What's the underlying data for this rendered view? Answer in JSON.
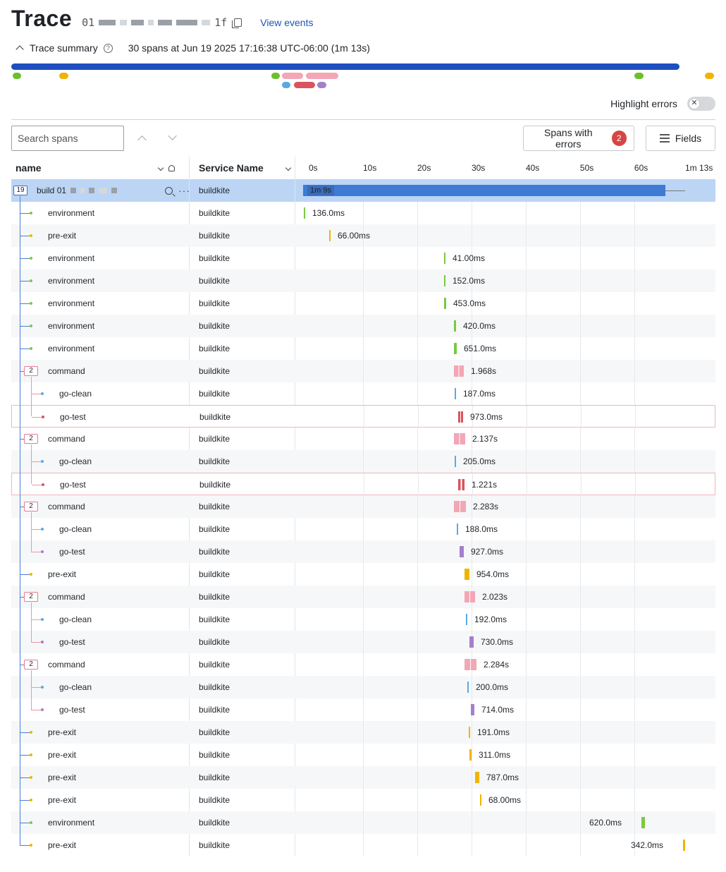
{
  "header": {
    "title": "Trace",
    "trace_id_prefix": "01",
    "trace_id_suffix": "1f",
    "view_events": "View events"
  },
  "summary": {
    "toggle_label": "Trace summary",
    "text": "30 spans at Jun 19 2025 17:16:38 UTC-06:00 (1m 13s)"
  },
  "highlight_errors": {
    "label": "Highlight errors",
    "enabled": false,
    "knob": "✕"
  },
  "toolbar": {
    "search_placeholder": "Search spans",
    "errors_label": "Spans with errors",
    "errors_count": "2",
    "fields_label": "Fields"
  },
  "columns": {
    "name": "name",
    "service": "Service Name"
  },
  "timeline_ticks": [
    "0s",
    "10s",
    "20s",
    "30s",
    "40s",
    "50s",
    "60s",
    "1m 13s"
  ],
  "colors": {
    "environment": "#7ac943",
    "pre-exit": "#f0b400",
    "command": "#f3a6b5",
    "go-clean": "#5aa9e6",
    "go-test": "#a57fcc",
    "go-test-error": "#d9545e",
    "root": "#3d7bd4"
  },
  "root_span": {
    "label": "build 01",
    "child_count": "19",
    "duration": "1m 9s",
    "service": "buildkite"
  },
  "spans": [
    {
      "name": "environment",
      "service": "buildkite",
      "duration": "136.0ms",
      "kind": "environment"
    },
    {
      "name": "pre-exit",
      "service": "buildkite",
      "duration": "66.00ms",
      "kind": "pre-exit"
    },
    {
      "name": "environment",
      "service": "buildkite",
      "duration": "41.00ms",
      "kind": "environment"
    },
    {
      "name": "environment",
      "service": "buildkite",
      "duration": "152.0ms",
      "kind": "environment"
    },
    {
      "name": "environment",
      "service": "buildkite",
      "duration": "453.0ms",
      "kind": "environment"
    },
    {
      "name": "environment",
      "service": "buildkite",
      "duration": "420.0ms",
      "kind": "environment"
    },
    {
      "name": "environment",
      "service": "buildkite",
      "duration": "651.0ms",
      "kind": "environment"
    },
    {
      "name": "command",
      "service": "buildkite",
      "duration": "1.968s",
      "kind": "command",
      "child_count": "2"
    },
    {
      "name": "go-clean",
      "service": "buildkite",
      "duration": "187.0ms",
      "kind": "go-clean"
    },
    {
      "name": "go-test",
      "service": "buildkite",
      "duration": "973.0ms",
      "kind": "go-test-error"
    },
    {
      "name": "command",
      "service": "buildkite",
      "duration": "2.137s",
      "kind": "command",
      "child_count": "2"
    },
    {
      "name": "go-clean",
      "service": "buildkite",
      "duration": "205.0ms",
      "kind": "go-clean"
    },
    {
      "name": "go-test",
      "service": "buildkite",
      "duration": "1.221s",
      "kind": "go-test-error"
    },
    {
      "name": "command",
      "service": "buildkite",
      "duration": "2.283s",
      "kind": "command",
      "child_count": "2"
    },
    {
      "name": "go-clean",
      "service": "buildkite",
      "duration": "188.0ms",
      "kind": "go-clean"
    },
    {
      "name": "go-test",
      "service": "buildkite",
      "duration": "927.0ms",
      "kind": "go-test"
    },
    {
      "name": "pre-exit",
      "service": "buildkite",
      "duration": "954.0ms",
      "kind": "pre-exit"
    },
    {
      "name": "command",
      "service": "buildkite",
      "duration": "2.023s",
      "kind": "command",
      "child_count": "2"
    },
    {
      "name": "go-clean",
      "service": "buildkite",
      "duration": "192.0ms",
      "kind": "go-clean"
    },
    {
      "name": "go-test",
      "service": "buildkite",
      "duration": "730.0ms",
      "kind": "go-test"
    },
    {
      "name": "command",
      "service": "buildkite",
      "duration": "2.284s",
      "kind": "command",
      "child_count": "2"
    },
    {
      "name": "go-clean",
      "service": "buildkite",
      "duration": "200.0ms",
      "kind": "go-clean"
    },
    {
      "name": "go-test",
      "service": "buildkite",
      "duration": "714.0ms",
      "kind": "go-test"
    },
    {
      "name": "pre-exit",
      "service": "buildkite",
      "duration": "191.0ms",
      "kind": "pre-exit"
    },
    {
      "name": "pre-exit",
      "service": "buildkite",
      "duration": "311.0ms",
      "kind": "pre-exit"
    },
    {
      "name": "pre-exit",
      "service": "buildkite",
      "duration": "787.0ms",
      "kind": "pre-exit"
    },
    {
      "name": "pre-exit",
      "service": "buildkite",
      "duration": "68.00ms",
      "kind": "pre-exit"
    },
    {
      "name": "environment",
      "service": "buildkite",
      "duration": "620.0ms",
      "kind": "environment"
    },
    {
      "name": "pre-exit",
      "service": "buildkite",
      "duration": "342.0ms",
      "kind": "pre-exit"
    }
  ]
}
